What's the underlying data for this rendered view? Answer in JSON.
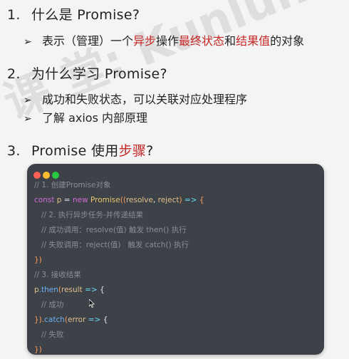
{
  "sections": [
    {
      "num": "1.",
      "title": "什么是 Promise?"
    },
    {
      "num": "2.",
      "title": "为什么学习 Promise?"
    },
    {
      "num": "3.",
      "title_prefix": "Promise 使用",
      "title_highlight": "步骤",
      "title_suffix": "?"
    }
  ],
  "bullet1": {
    "p1": "表示（管理）一个",
    "h1": "异步",
    "p2": "操作",
    "h2": "最终状态",
    "p3": "和",
    "h3": "结果值",
    "p4": "的对象"
  },
  "bullets2": [
    "成功和失败状态，可以关联对应处理程序",
    "了解 axios 内部原理"
  ],
  "watermark": "课 堂: Kunlun991",
  "code": {
    "comment1": "// 1. 创建Promise对象",
    "l2_const": "const",
    "l2_p": "p",
    "l2_eq": " = ",
    "l2_new": "new",
    "l2_promise": "Promise",
    "l2_open": "((",
    "l2_resolve": "resolve",
    "l2_comma": ", ",
    "l2_reject": "reject",
    "l2_close": ")",
    "l2_arrow": " => ",
    "l2_brace": "{",
    "comment2": "// 2. 执行异步任务-并传递结果",
    "comment3": "// 成功调用：resolve(值) 触发 then() 执行",
    "comment4": "// 失败调用：reject(值)   触发 catch() 执行",
    "l6": "})",
    "comment5": "// 3. 接收结果",
    "l8_p": "p",
    "l8_then": ".then",
    "l8_open": "(",
    "l8_result": "result",
    "l8_arrow": " => ",
    "l8_brace": "{",
    "comment6": "// 成功",
    "l10_close": "}).",
    "l10_catch": "catch",
    "l10_open": "(",
    "l10_error": "error",
    "l10_arrow": " => ",
    "l10_brace": "{",
    "comment7": "// 失败",
    "l12": "})"
  },
  "colors": {
    "highlight": "#c62828",
    "code_bg": "#3d4148",
    "dot_red": "#ff5f56",
    "dot_yellow": "#ffbd2e",
    "dot_green": "#27c93f"
  }
}
